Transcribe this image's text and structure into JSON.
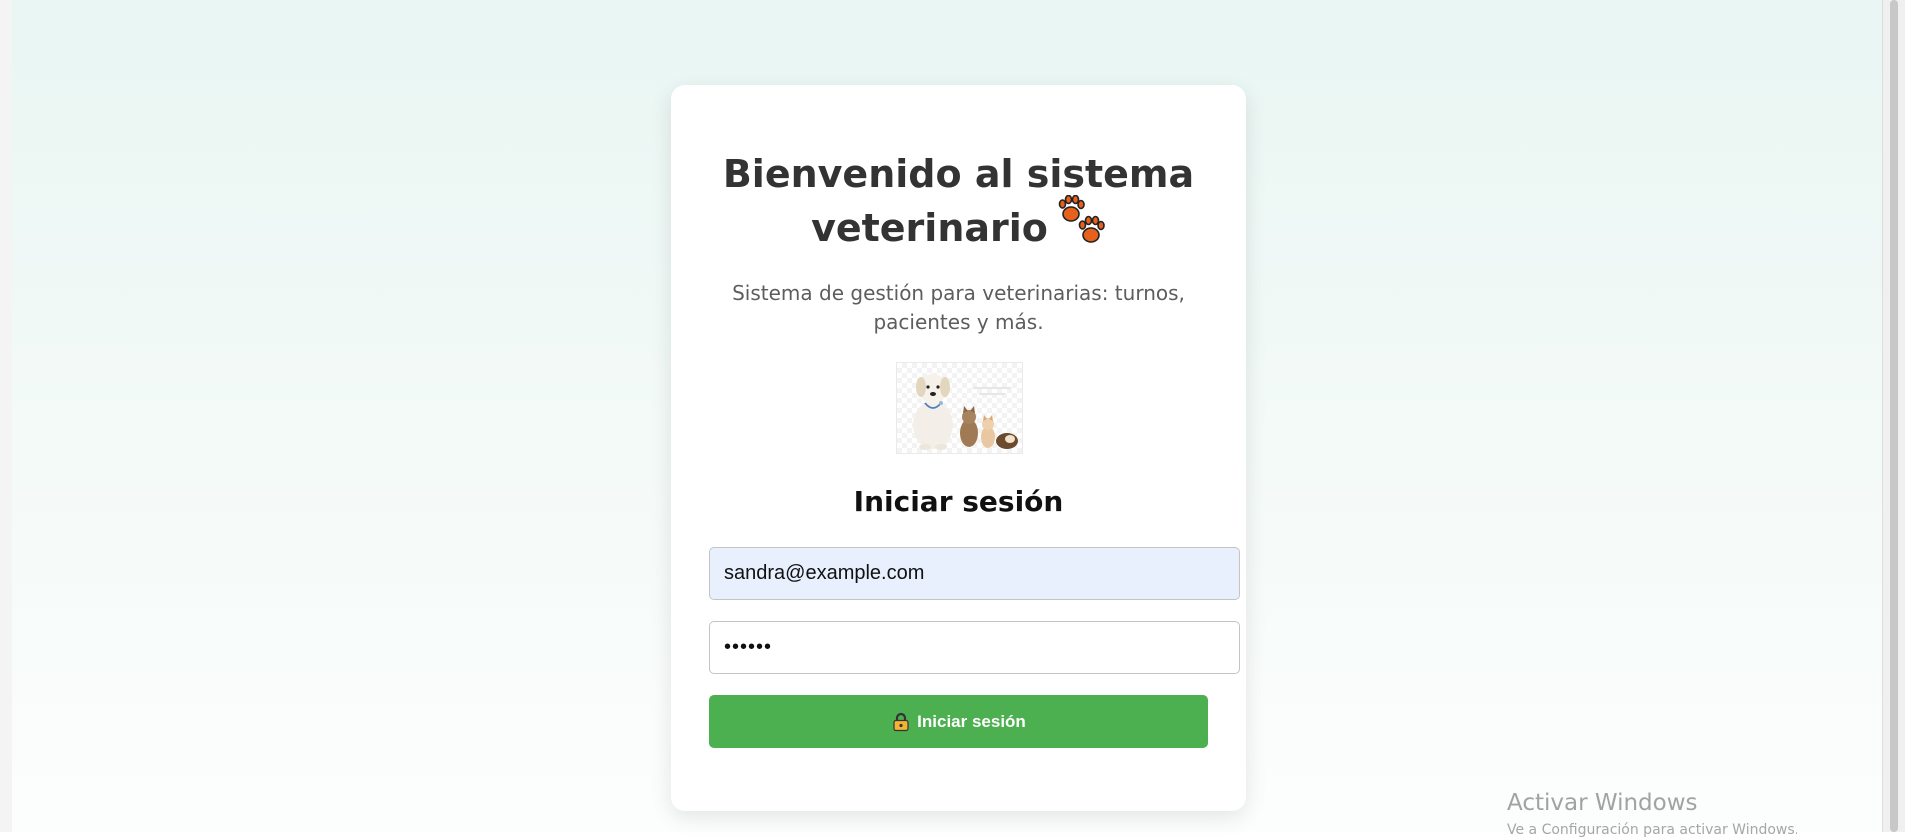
{
  "header": {
    "title_line1": "Bienvenido al sistema",
    "title_line2": "veterinario",
    "title_icon": "paw-prints",
    "subtitle_line1": "Sistema de gestión para veterinarias: turnos,",
    "subtitle_line2": "pacientes y más."
  },
  "hero_image": {
    "description_icon": "vet-pets-image"
  },
  "login": {
    "title": "Iniciar sesión",
    "email_value": "sandra@example.com",
    "password_value": "••••••",
    "button_label": "Iniciar sesión",
    "button_icon": "lock-icon",
    "button_color": "#4caf50"
  },
  "windows_watermark": {
    "title": "Activar Windows",
    "subtitle": "Ve a Configuración para activar Windows."
  },
  "colors": {
    "background_top": "#e9f6f3",
    "card": "#ffffff",
    "email_autofill": "#e8f0fe",
    "paw": "#e8611c"
  }
}
